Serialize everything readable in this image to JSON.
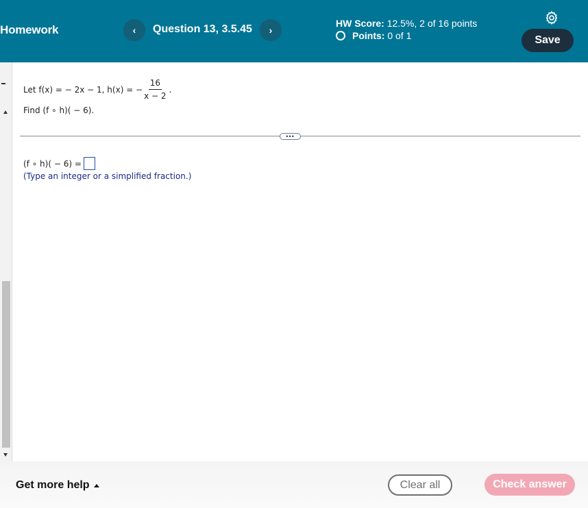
{
  "header": {
    "title": "Homework",
    "question_label": "Question 13, 3.5.45",
    "prev_icon": "chevron-left-icon",
    "next_icon": "chevron-right-icon",
    "prev_glyph": "‹",
    "next_glyph": "›",
    "hw_score_label": "HW Score:",
    "hw_score_value": "12.5%, 2 of 16 points",
    "points_label": "Points:",
    "points_value": "0 of 1",
    "save_label": "Save",
    "settings_icon": "gear-icon"
  },
  "question": {
    "given_prefix": "Let f(x) = − 2x − 1, h(x) = −",
    "fraction_numerator": "16",
    "fraction_denominator": "x − 2",
    "given_suffix": ".",
    "task": "Find (f ∘ h)( − 6).",
    "expand_handle": "•••"
  },
  "answer": {
    "prompt": "(f ∘ h)( − 6) =",
    "value": "",
    "hint": "(Type an integer or a simplified fraction.)"
  },
  "footer": {
    "help_label": "Get more help",
    "clear_label": "Clear all",
    "check_label": "Check answer"
  },
  "colors": {
    "header_bg": "#007596",
    "nav_button_bg": "#135f78",
    "save_bg": "#1d2e3c",
    "check_answer_bg": "#f2a8b4",
    "hint_text": "#1a2a8a",
    "answer_box_border": "#1f4fa0"
  }
}
